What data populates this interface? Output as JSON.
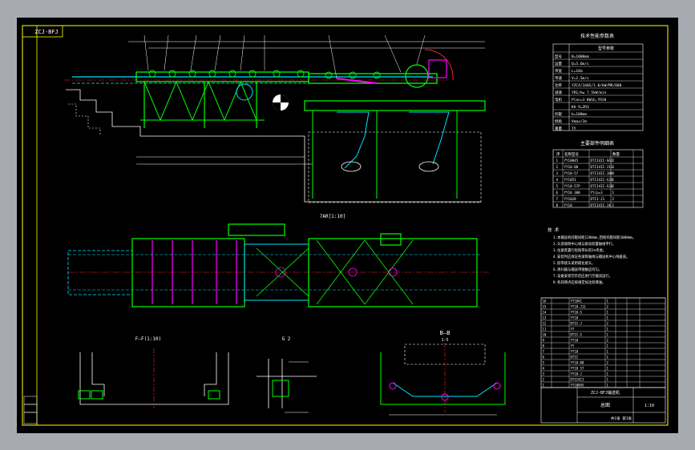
{
  "colors": {
    "background": "#a7aab1",
    "canvas": "#000000",
    "frame": "#ffff00",
    "primary": "#00ff00",
    "secondary": "#00e5ff",
    "accent": "#ff00ff",
    "annotation": "#ffffff",
    "centerline": "#ff2020"
  },
  "title_tag": "ZCJ-BFJ",
  "view_labels": {
    "f_f": "F—F(1:10)",
    "g": "G",
    "g_2": "G 2",
    "b_b": "B—B",
    "b_scale": "1:5",
    "plan": "7AR[1:10]"
  },
  "tech_table": {
    "title": "技术性能参数表",
    "header": "型号参数",
    "rows": [
      {
        "label": "型号",
        "value": "B=1000mm"
      },
      {
        "label": "运量",
        "value": "Q=5.6m/s"
      },
      {
        "label": "带宽",
        "value": "L=18m"
      },
      {
        "label": "带速",
        "value": "V=2.5m/s"
      },
      {
        "label": "功率",
        "value": "YZC4/160S/1.0/kW/MR/800"
      },
      {
        "label": "减速",
        "value": "YR1/kw 7.5kW/min"
      },
      {
        "label": "电机",
        "value": "Plan=3 KW1b,YR18"
      },
      {
        "label": "",
        "value": "KH 9=2R3"
      },
      {
        "label": "托辊",
        "value": "b=108mm"
      },
      {
        "label": "倾角",
        "value": "Vmax/2m"
      },
      {
        "label": "重量",
        "value": "TY"
      }
    ]
  },
  "parts_table": {
    "title": "主要部件明细表",
    "header": [
      "序",
      "名称型号",
      "",
      "数量"
    ],
    "rows": [
      [
        "1",
        "YY10045",
        "DTII4II-S61",
        "2"
      ],
      [
        "2",
        "YY10-08",
        "DTII4II-J11",
        "3"
      ],
      [
        "3",
        "YY10-57",
        "DTII4II-J08",
        "4"
      ],
      [
        "4",
        "YY1051",
        "DTII4II-S24",
        "1"
      ],
      [
        "5",
        "YY10-57P",
        "DTII4II-S24",
        "2"
      ],
      [
        "6",
        "YY10 300",
        "YY/p=3",
        "1"
      ],
      [
        "7",
        "YY1028",
        "DTII-J1",
        "2"
      ],
      [
        "8",
        "YY10",
        "DTII4II-J4",
        "1"
      ]
    ]
  },
  "notes": {
    "title": "技 术",
    "items": [
      "1.本输送机托辊间距1200mm,回程托辊间距3000mm。",
      "2.头部滚筒中心线与驱动装置轴线平行。",
      "3.拉紧装置行程按带长的1%考虑。",
      "4.安装时应保证各滚筒轴线与输送机中心线垂直。",
      "5.胶带接头采用硫化接头。",
      "6.清扫器与输送带接触应均匀。",
      "7.设备安装完毕后应进行空载试运行。",
      "8.各润滑点应按规定加注润滑油。"
    ]
  },
  "bom": {
    "rows": [
      [
        "16",
        "",
        "YY1041",
        "1",
        "",
        "",
        ""
      ],
      [
        "15",
        "",
        "YY10-J11",
        "2",
        "",
        "",
        ""
      ],
      [
        "14",
        "",
        "YY10-S",
        "1",
        "",
        "",
        ""
      ],
      [
        "13",
        "",
        "YY10",
        "1",
        "",
        "",
        ""
      ],
      [
        "12",
        "",
        "DTII-J",
        "2",
        "",
        "",
        ""
      ],
      [
        "11",
        "",
        "YY",
        "1",
        "",
        "",
        ""
      ],
      [
        "10",
        "",
        "DTII-S",
        "1",
        "",
        "",
        ""
      ],
      [
        "9",
        "",
        "YY10",
        "2",
        "",
        "",
        ""
      ],
      [
        "8",
        "",
        "YY",
        "1",
        "",
        "",
        ""
      ],
      [
        "7",
        "",
        "YY10",
        "1",
        "",
        "",
        ""
      ],
      [
        "6",
        "",
        "DTII",
        "1",
        "",
        "",
        ""
      ],
      [
        "5",
        "",
        "YY10-08",
        "2",
        "",
        "",
        ""
      ],
      [
        "4",
        "",
        "YY10 57",
        "1",
        "",
        "",
        ""
      ],
      [
        "3",
        "",
        "YY10-J",
        "1",
        "",
        "",
        ""
      ],
      [
        "2",
        "",
        "DTII4II",
        "1",
        "",
        "",
        ""
      ],
      [
        "1",
        "",
        "YY10045",
        "1",
        "",
        "",
        ""
      ]
    ]
  },
  "title_block": {
    "project": "ZCJ-BFJ输送机",
    "drawing": "总图",
    "scale": "1:10",
    "sheet": "共1张 第1张"
  }
}
